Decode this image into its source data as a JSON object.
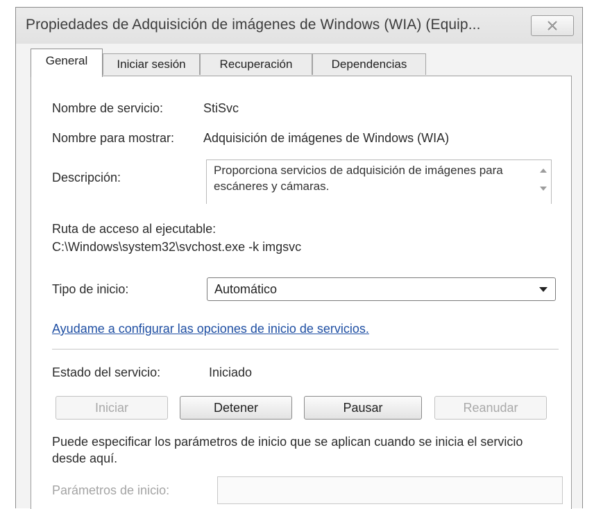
{
  "window": {
    "title": "Propiedades de Adquisición de imágenes de Windows (WIA) (Equip...",
    "close_icon": "close-icon"
  },
  "tabs": [
    {
      "label": "General",
      "active": true
    },
    {
      "label": "Iniciar sesión",
      "active": false
    },
    {
      "label": "Recuperación",
      "active": false
    },
    {
      "label": "Dependencias",
      "active": false
    }
  ],
  "general": {
    "service_name_label": "Nombre de servicio:",
    "service_name_value": "StiSvc",
    "display_name_label": "Nombre para mostrar:",
    "display_name_value": "Adquisición de imágenes de Windows (WIA)",
    "description_label": "Descripción:",
    "description_value": "Proporciona servicios de adquisición de imágenes para escáneres y cámaras.",
    "exe_path_label": "Ruta de acceso al ejecutable:",
    "exe_path_value": "C:\\Windows\\system32\\svchost.exe -k imgsvc",
    "startup_type_label": "Tipo de inicio:",
    "startup_type_value": "Automático",
    "help_link": "Ayudame a configurar las opciones de inicio de servicios.",
    "status_label": "Estado del servicio:",
    "status_value": "Iniciado",
    "buttons": {
      "start": "Iniciar",
      "stop": "Detener",
      "pause": "Pausar",
      "resume": "Reanudar"
    },
    "params_note": "Puede especificar los parámetros de inicio que se aplican cuando se inicia el servicio desde aquí.",
    "params_label": "Parámetros de inicio:",
    "params_value": ""
  },
  "colors": {
    "link": "#1f4fa3",
    "disabled_text": "#a9a9a9"
  }
}
